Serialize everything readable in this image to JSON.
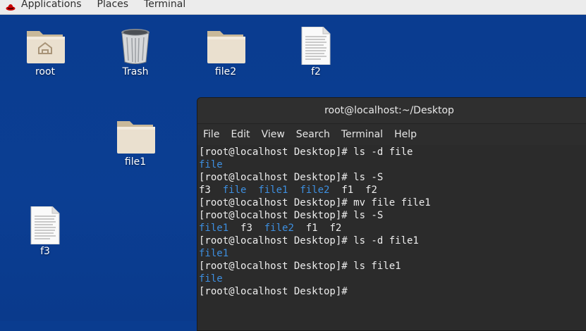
{
  "topbar": {
    "applications": "Applications",
    "places": "Places",
    "terminal": "Terminal"
  },
  "desktop": {
    "icons": [
      {
        "label": "root",
        "icon": "home-folder-icon"
      },
      {
        "label": "Trash",
        "icon": "trash-icon"
      },
      {
        "label": "file2",
        "icon": "folder-icon"
      },
      {
        "label": "f2",
        "icon": "text-file-icon"
      },
      {
        "label": "file1",
        "icon": "folder-icon"
      },
      {
        "label": "f3",
        "icon": "text-file-icon"
      }
    ]
  },
  "terminal": {
    "title": "root@localhost:~/Desktop",
    "menu": [
      "File",
      "Edit",
      "View",
      "Search",
      "Terminal",
      "Help"
    ],
    "lines": [
      "[root@localhost Desktop]# ls -d file",
      "file",
      "[root@localhost Desktop]# ls -S",
      "f3  file  file1  file2  f1  f2",
      "[root@localhost Desktop]# mv file file1",
      "[root@localhost Desktop]# ls -S",
      "file1  f3  file2  f1  f2",
      "[root@localhost Desktop]# ls -d file1",
      "file1",
      "[root@localhost Desktop]# ls file1",
      "file",
      "[root@localhost Desktop]#"
    ]
  },
  "colors": {
    "desktop_bg": "#0b3d91",
    "dir_blue": "#3d8fe0",
    "terminal_bg": "#2b2b2b"
  }
}
